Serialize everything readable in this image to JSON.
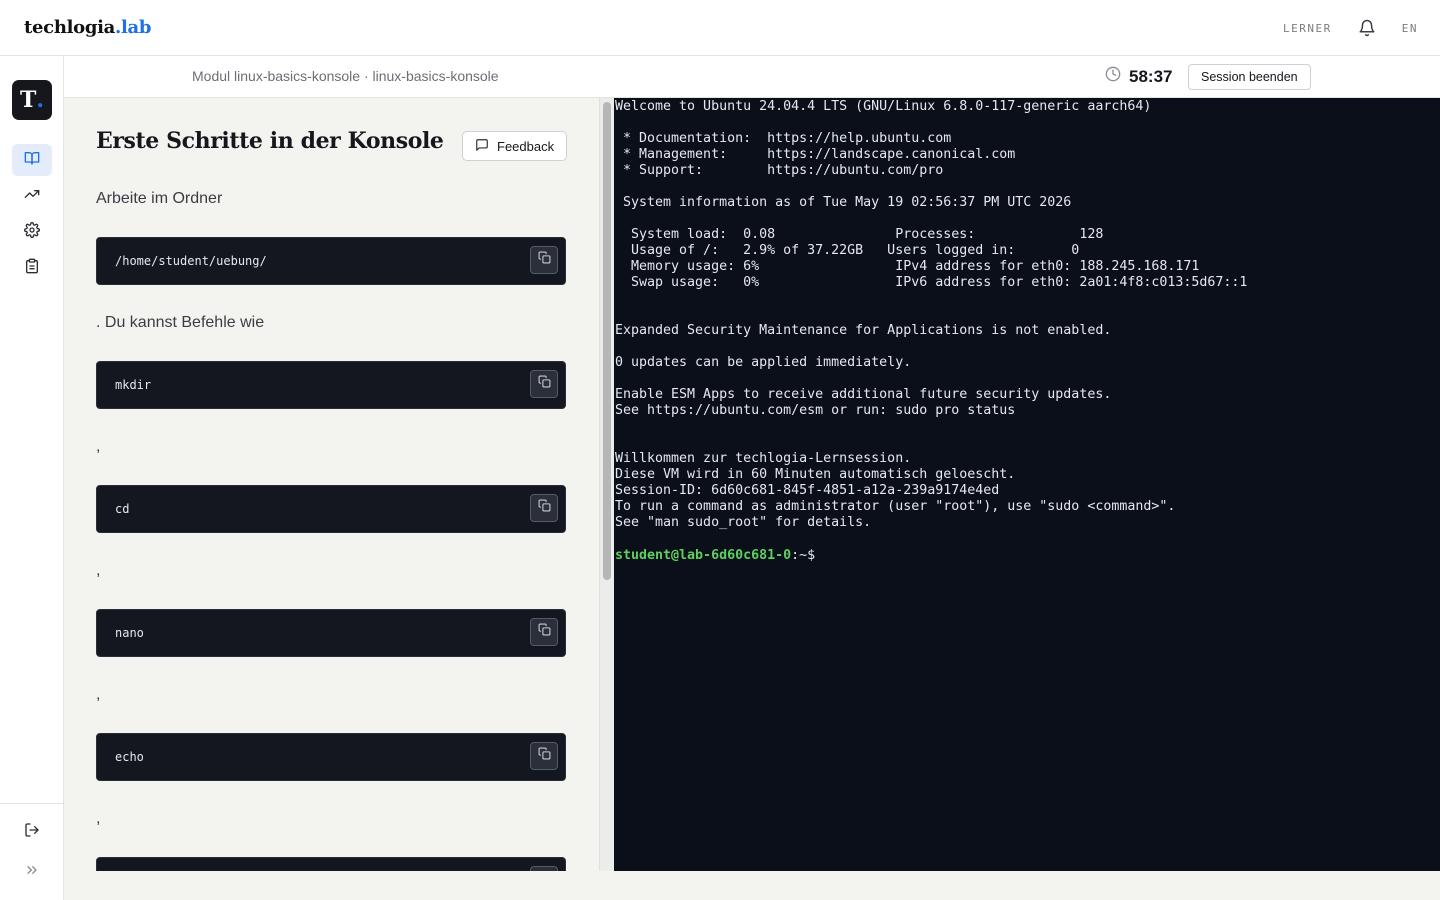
{
  "header": {
    "brand_main": "techlogia",
    "brand_dot": ".",
    "brand_suffix": "lab",
    "role": "LERNER",
    "language": "EN"
  },
  "rail": {
    "logo_letter": "T",
    "logo_dot": ".",
    "items": [
      {
        "icon": "book-icon",
        "active": true
      },
      {
        "icon": "trending-up-icon",
        "active": false
      },
      {
        "icon": "gear-icon",
        "active": false
      },
      {
        "icon": "clipboard-icon",
        "active": false
      }
    ],
    "logout_icon": "logout-icon",
    "expand_icon": "double-chevron-right-icon"
  },
  "session": {
    "breadcrumb": "Modul linux-basics-konsole · linux-basics-konsole",
    "timer": "58:37",
    "end_button": "Session beenden"
  },
  "lesson": {
    "title": "Erste Schritte in der Konsole",
    "feedback_button": "Feedback",
    "blocks": [
      {
        "type": "text",
        "value": "Arbeite im Ordner"
      },
      {
        "type": "code",
        "value": "/home/student/uebung/"
      },
      {
        "type": "text",
        "value": ". Du kannst Befehle wie"
      },
      {
        "type": "code",
        "value": "mkdir"
      },
      {
        "type": "text",
        "value": ","
      },
      {
        "type": "code",
        "value": "cd"
      },
      {
        "type": "text",
        "value": ","
      },
      {
        "type": "code",
        "value": "nano"
      },
      {
        "type": "text",
        "value": ","
      },
      {
        "type": "code",
        "value": "echo"
      },
      {
        "type": "text",
        "value": ","
      }
    ]
  },
  "terminal": {
    "output": "Welcome to Ubuntu 24.04.4 LTS (GNU/Linux 6.8.0-117-generic aarch64)\n\n * Documentation:  https://help.ubuntu.com\n * Management:     https://landscape.canonical.com\n * Support:        https://ubuntu.com/pro\n\n System information as of Tue May 19 02:56:37 PM UTC 2026\n\n  System load:  0.08               Processes:             128\n  Usage of /:   2.9% of 37.22GB   Users logged in:       0\n  Memory usage: 6%                 IPv4 address for eth0: 188.245.168.171\n  Swap usage:   0%                 IPv6 address for eth0: 2a01:4f8:c013:5d67::1\n\n\nExpanded Security Maintenance for Applications is not enabled.\n\n0 updates can be applied immediately.\n\nEnable ESM Apps to receive additional future security updates.\nSee https://ubuntu.com/esm or run: sudo pro status\n\n\nWillkommen zur techlogia-Lernsession.\nDiese VM wird in 60 Minuten automatisch geloescht.\nSession-ID: 6d60c681-845f-4851-a12a-239a9174e4ed\nTo run a command as administrator (user \"root\"), use \"sudo <command>\".\nSee \"man sudo_root\" for details.",
    "prompt_user": "student@lab-6d60c681-0",
    "prompt_rest": ":~$"
  },
  "colors": {
    "accent": "#1f6fe5",
    "terminal_bg": "#0b0f1a",
    "prompt_green": "#5ed05e",
    "code_bg": "#14171f"
  }
}
